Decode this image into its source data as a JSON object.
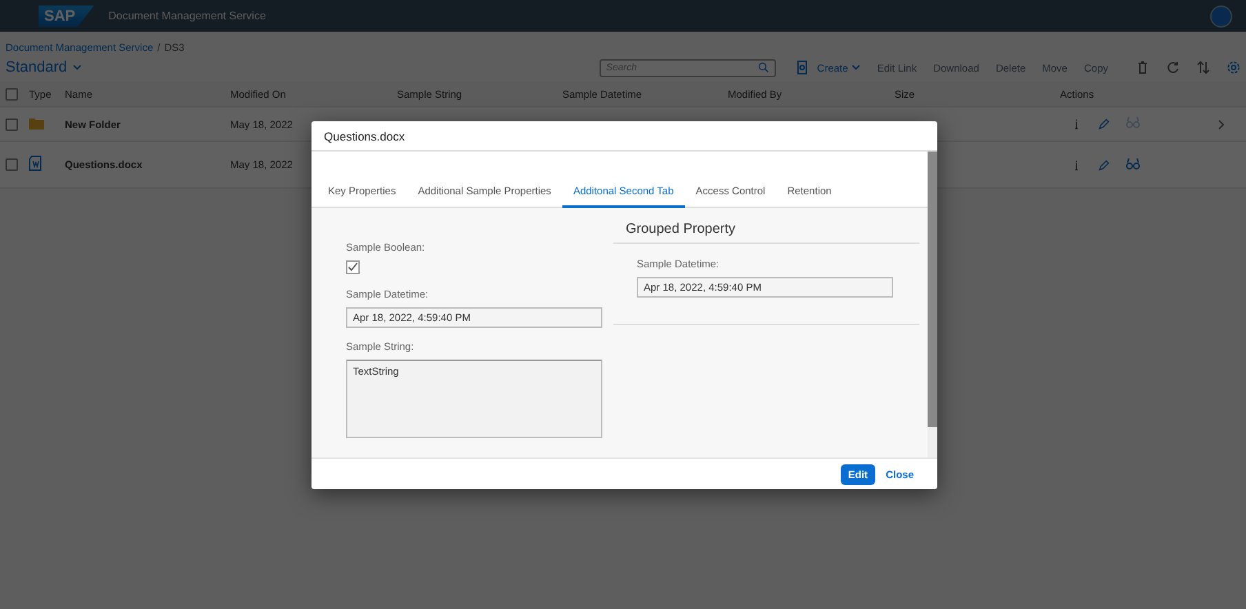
{
  "header": {
    "logo": "SAP",
    "title": "Document Management Service"
  },
  "breadcrumb": {
    "links": [
      "Document Management Service"
    ],
    "separator": "/",
    "current": "DS3"
  },
  "variant": "Standard",
  "search": {
    "placeholder": "Search"
  },
  "toolbar": [
    {
      "label": "Create",
      "disabled": false,
      "menu": true
    },
    {
      "label": "Edit Link",
      "disabled": true,
      "menu": false
    },
    {
      "label": "Download",
      "disabled": true,
      "menu": false
    },
    {
      "label": "Delete",
      "disabled": true,
      "menu": false
    },
    {
      "label": "Move",
      "disabled": true,
      "menu": false
    },
    {
      "label": "Copy",
      "disabled": true,
      "menu": false
    }
  ],
  "table": {
    "select_all_checked": false,
    "columns": [
      "Type",
      "Name",
      "Modified On",
      "Sample String",
      "Sample Datetime",
      "Modified By",
      "Size",
      "Actions"
    ],
    "rows": [
      {
        "kind": "folder",
        "name": "New Folder",
        "modified_on": "May 18, 2022",
        "checked": false,
        "preview_disabled": true,
        "navigable": true
      },
      {
        "kind": "document",
        "name": "Questions.docx",
        "modified_on": "May 18, 2022",
        "checked": false,
        "preview_disabled": false,
        "navigable": false
      }
    ]
  },
  "dialog": {
    "title": "Questions.docx",
    "tabs": [
      {
        "label": "Key Properties",
        "selected": false
      },
      {
        "label": "Additional Sample Properties",
        "selected": false
      },
      {
        "label": "Additonal Second Tab",
        "selected": true
      },
      {
        "label": "Access Control",
        "selected": false
      },
      {
        "label": "Retention",
        "selected": false
      }
    ],
    "fields": [
      {
        "kind": "checkbox",
        "label": "Sample Boolean:",
        "checked": true
      },
      {
        "kind": "input",
        "label": "Sample Datetime:",
        "value": "Apr 18, 2022, 4:59:40 PM"
      },
      {
        "kind": "textarea",
        "label": "Sample String:",
        "value": "TextString"
      }
    ],
    "group": {
      "title": "Grouped Property",
      "fields": [
        {
          "kind": "input",
          "label": "Sample Datetime:",
          "value": "Apr 18, 2022, 4:59:40 PM"
        }
      ]
    },
    "buttons": [
      {
        "label": "Edit",
        "kind": "emphasized"
      },
      {
        "label": "Close",
        "kind": "transparent"
      }
    ]
  }
}
